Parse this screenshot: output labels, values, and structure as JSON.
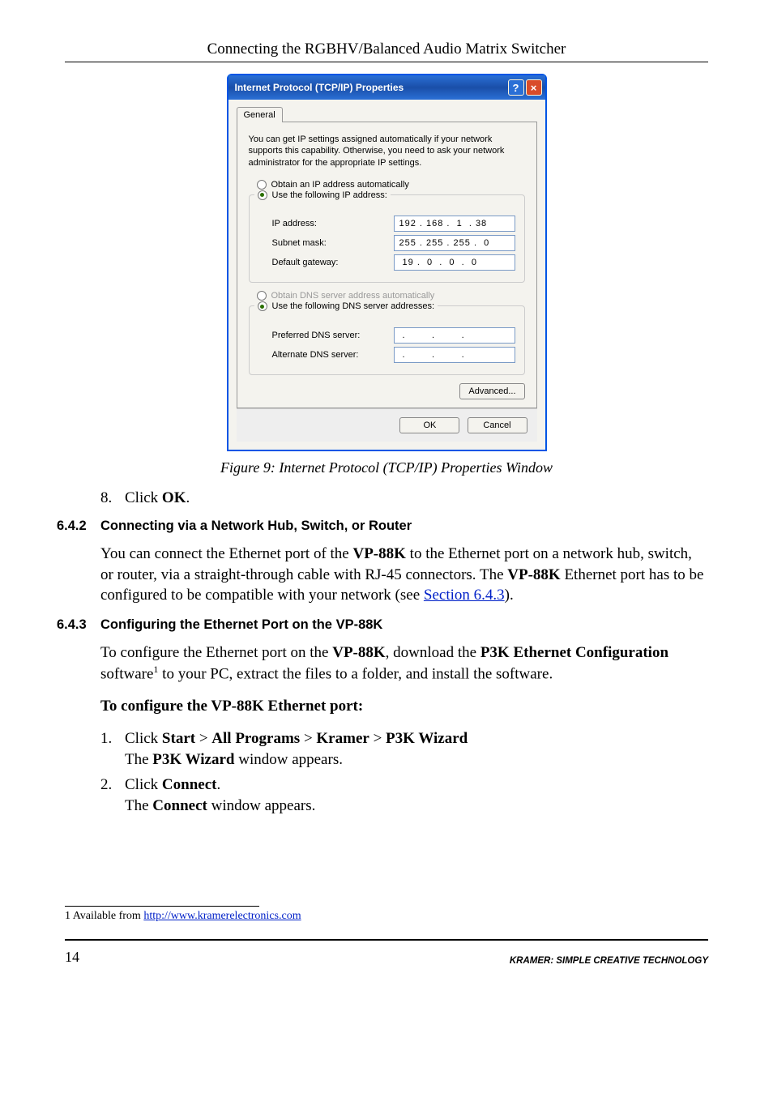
{
  "header_title": "Connecting the RGBHV/Balanced Audio Matrix Switcher",
  "dialog": {
    "title": "Internet Protocol (TCP/IP) Properties",
    "tab_general": "General",
    "description": "You can get IP settings assigned automatically if your network supports this capability. Otherwise, you need to ask your network administrator for the appropriate IP settings.",
    "radio_auto_ip": "Obtain an IP address automatically",
    "radio_use_ip": "Use the following IP address:",
    "lbl_ip": "IP address:",
    "lbl_subnet": "Subnet mask:",
    "lbl_gateway": "Default gateway:",
    "val_ip": "192 . 168 .  1  . 38",
    "val_subnet": "255 . 255 . 255 .  0",
    "val_gateway": " 19 .  0  .  0  .  0",
    "radio_auto_dns": "Obtain DNS server address automatically",
    "radio_use_dns": "Use the following DNS server addresses:",
    "lbl_pref_dns": "Preferred DNS server:",
    "lbl_alt_dns": "Alternate DNS server:",
    "val_dns_blank": " .        .        . ",
    "btn_advanced": "Advanced...",
    "btn_ok": "OK",
    "btn_cancel": "Cancel"
  },
  "figure_caption": "Figure 9: Internet Protocol (TCP/IP) Properties Window",
  "step8": {
    "num": "8.",
    "pre": "Click ",
    "bold": "OK",
    "post": "."
  },
  "sec642": {
    "num": "6.4.2",
    "title": "Connecting via a Network Hub, Switch, or Router",
    "p1a": "You can connect the Ethernet port of the ",
    "p1b": "VP-88K",
    "p1c": " to the Ethernet port on a network hub, switch, or router, via a straight-through cable with RJ-45 connectors. The ",
    "p1d": "VP-88K",
    "p1e": " Ethernet port has to be configured to be compatible with your network (see ",
    "p1link": "Section 6.4.3",
    "p1f": ")."
  },
  "sec643": {
    "num": "6.4.3",
    "title": "Configuring the Ethernet Port on the VP-88K",
    "p1a": "To configure the Ethernet port on the ",
    "p1b": "VP-88K",
    "p1c": ", download the ",
    "p1d": "P3K Ethernet Configuration",
    "p1e": " software",
    "p1f": " to your PC, extract the files to a folder, and install the software.",
    "intro": "To configure the VP-88K Ethernet port:",
    "i1_num": "1.",
    "i1a": "Click ",
    "i1b": "Start",
    "i1c": " > ",
    "i1d": "All Programs",
    "i1e": " > ",
    "i1f": "Kramer",
    "i1g": " > ",
    "i1h": "P3K Wizard",
    "i1_line2a": "The ",
    "i1_line2b": "P3K Wizard",
    "i1_line2c": " window appears.",
    "i2_num": "2.",
    "i2a": "Click ",
    "i2b": "Connect",
    "i2c": ".",
    "i2_line2a": "The ",
    "i2_line2b": "Connect",
    "i2_line2c": " window appears."
  },
  "footnote": {
    "pre": "1 Available from ",
    "link": "http://www.kramerelectronics.com"
  },
  "footer": {
    "page": "14",
    "brand": "KRAMER:  SIMPLE CREATIVE TECHNOLOGY"
  }
}
